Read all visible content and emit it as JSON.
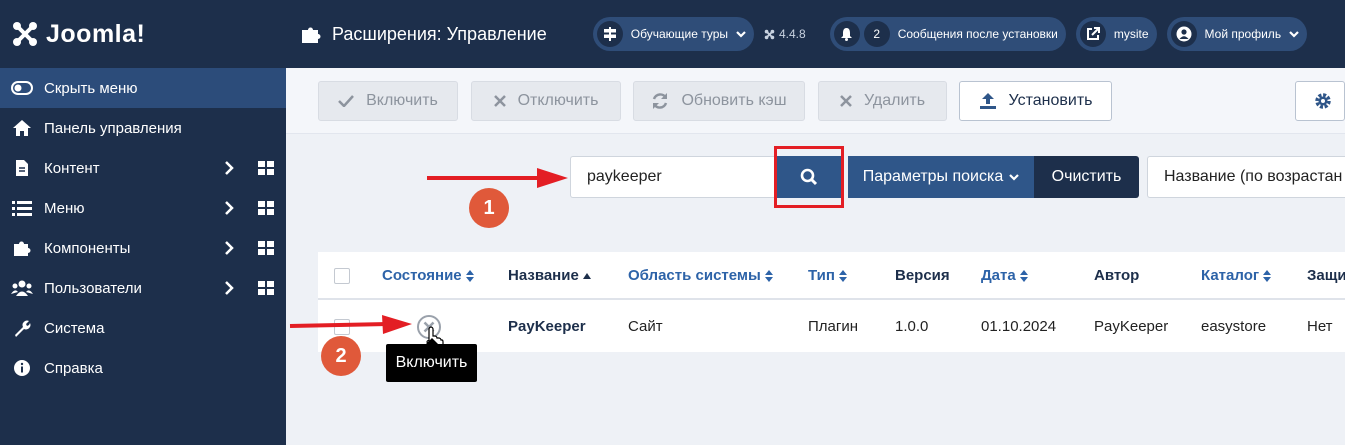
{
  "brand": {
    "name": "Joomla!"
  },
  "sidebar": {
    "items": [
      {
        "label": "Скрыть меню",
        "icon": "toggle-icon"
      },
      {
        "label": "Панель управления",
        "icon": "home-icon"
      },
      {
        "label": "Контент",
        "icon": "file-icon"
      },
      {
        "label": "Меню",
        "icon": "list-icon"
      },
      {
        "label": "Компоненты",
        "icon": "puzzle-icon"
      },
      {
        "label": "Пользователи",
        "icon": "users-icon"
      },
      {
        "label": "Система",
        "icon": "wrench-icon"
      },
      {
        "label": "Справка",
        "icon": "info-icon"
      }
    ]
  },
  "header": {
    "title": "Расширения: Управление",
    "tours_label": "Обучающие туры",
    "version": "4.4.8",
    "messages_count": "2",
    "messages_label": "Сообщения после установки",
    "site_label": "mysite",
    "profile_label": "Мой профиль"
  },
  "toolbar": {
    "enable_label": "Включить",
    "disable_label": "Отключить",
    "refresh_label": "Обновить кэш",
    "delete_label": "Удалить",
    "install_label": "Установить"
  },
  "search": {
    "value": "paykeeper",
    "options_label": "Параметры поиска",
    "clear_label": "Очистить",
    "sort_value": "Название (по возрастан"
  },
  "table": {
    "headers": {
      "status": "Состояние",
      "name": "Название",
      "area": "Область системы",
      "type": "Тип",
      "version": "Версия",
      "date": "Дата",
      "author": "Автор",
      "folder": "Каталог",
      "protected": "Защи"
    },
    "row": {
      "name": "PayKeeper",
      "area": "Сайт",
      "type": "Плагин",
      "version": "1.0.0",
      "date": "01.10.2024",
      "author": "PayKeeper",
      "folder": "easystore",
      "protected": "Нет"
    }
  },
  "tooltip": {
    "text": "Включить"
  },
  "annotations": {
    "step1": "1",
    "step2": "2"
  },
  "colors": {
    "sidebar_bg": "#1d2f4b",
    "active_item": "#2c4c7a",
    "primary_button": "#2f5689",
    "annotation_red": "#e31e24",
    "step_badge": "#e0593a"
  }
}
